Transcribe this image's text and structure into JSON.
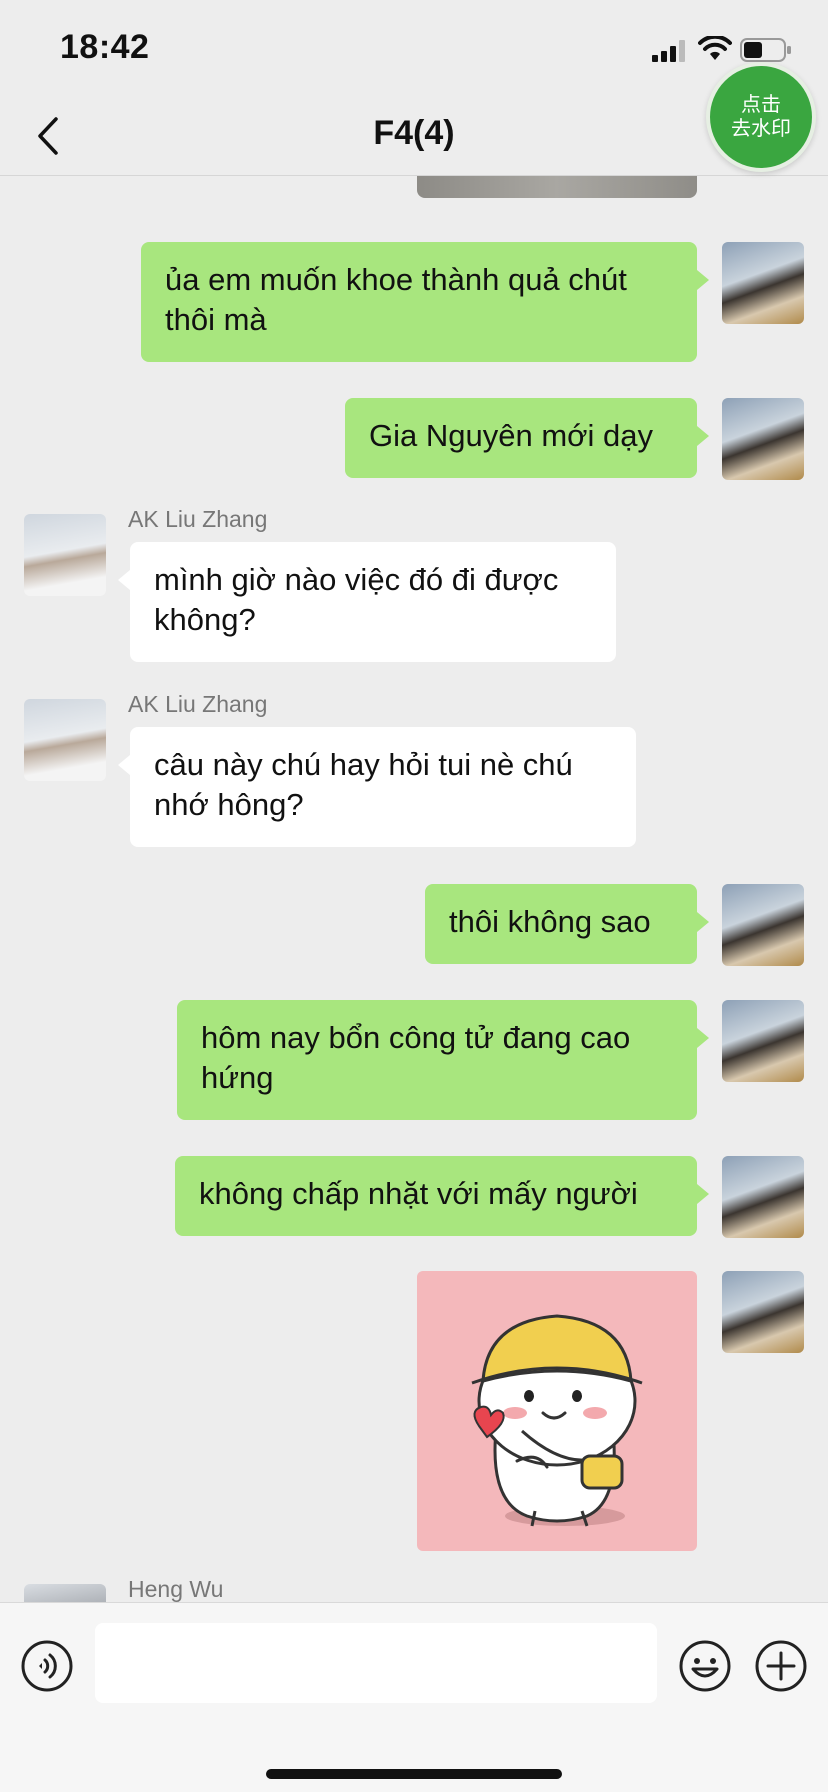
{
  "status_bar": {
    "time": "18:42"
  },
  "header": {
    "title": "F4(4)",
    "watermark_badge": [
      "点击",
      "去水印"
    ]
  },
  "messages": [
    {
      "side": "me",
      "text": "ủa em muốn khoe thành quả chút thôi mà"
    },
    {
      "side": "me",
      "text": "Gia Nguyên mới dạy"
    },
    {
      "side": "other",
      "sender": "AK Liu Zhang",
      "text": "mình giờ nào việc đó đi được không?"
    },
    {
      "side": "other",
      "sender": "AK Liu Zhang",
      "text": "câu này chú hay hỏi tui nè chú nhớ hông?"
    },
    {
      "side": "me",
      "text": "thôi không sao"
    },
    {
      "side": "me",
      "text": "hôm nay bổn công tử đang cao hứng"
    },
    {
      "side": "me",
      "text": "không chấp nhặt với mấy người"
    },
    {
      "side": "me",
      "type": "sticker",
      "sticker": "smiling-character-yellow-hat-sticker"
    },
    {
      "side": "other",
      "sender": "Heng Wu",
      "text": ""
    }
  ],
  "colors": {
    "my_bubble": "#a8e67e",
    "other_bubble": "#ffffff",
    "background": "#ededed",
    "badge": "#3aa640"
  }
}
